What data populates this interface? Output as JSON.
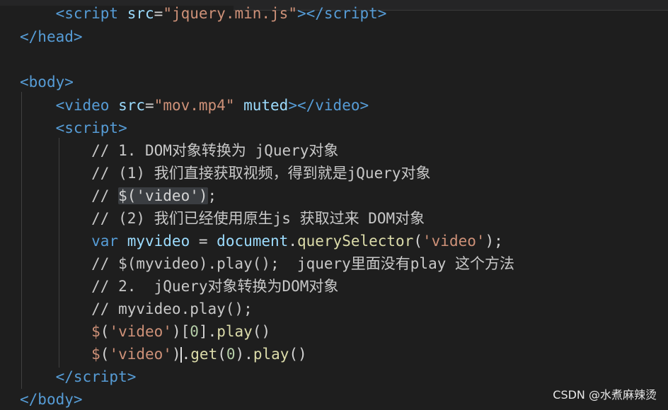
{
  "editor": {
    "lines": [
      {
        "parts": [
          [
            "tag",
            "    <"
          ],
          [
            "tag",
            "script"
          ],
          [
            "attr",
            " src"
          ],
          [
            "plain",
            "="
          ],
          [
            "str",
            "\"jquery.min.js\""
          ],
          [
            "tag",
            "></"
          ],
          [
            "tag",
            "script"
          ],
          [
            "tag",
            ">"
          ]
        ]
      },
      {
        "parts": [
          [
            "tag",
            "</"
          ],
          [
            "tag",
            "head"
          ],
          [
            "tag",
            ">"
          ]
        ]
      },
      {
        "parts": []
      },
      {
        "parts": [
          [
            "tag",
            "<"
          ],
          [
            "tag",
            "body"
          ],
          [
            "tag",
            ">"
          ]
        ]
      },
      {
        "parts": [
          [
            "tag",
            "    <"
          ],
          [
            "tag",
            "video"
          ],
          [
            "attr",
            " src"
          ],
          [
            "plain",
            "="
          ],
          [
            "str",
            "\"mov.mp4\""
          ],
          [
            "attr",
            " muted"
          ],
          [
            "tag",
            "></"
          ],
          [
            "tag",
            "video"
          ],
          [
            "tag",
            ">"
          ]
        ]
      },
      {
        "parts": [
          [
            "tag",
            "    <"
          ],
          [
            "tag",
            "script"
          ],
          [
            "tag",
            ">"
          ]
        ]
      },
      {
        "parts": [
          [
            "cmt",
            "        // 1. DOM对象转换为 jQuery对象"
          ]
        ]
      },
      {
        "parts": [
          [
            "cmt",
            "        // (1) 我们直接获取视频，得到就是jQuery对象"
          ]
        ]
      },
      {
        "parts": [
          [
            "cmt",
            "        // "
          ],
          [
            "hl",
            "$('video')"
          ],
          [
            "cmt",
            ";"
          ]
        ]
      },
      {
        "parts": [
          [
            "cmt",
            "        // (2) 我们已经使用原生js 获取过来 DOM对象"
          ]
        ]
      },
      {
        "parts": [
          [
            "kw",
            "        var"
          ],
          [
            "var",
            " myvideo"
          ],
          [
            "plain",
            " = "
          ],
          [
            "var",
            "document"
          ],
          [
            "plain",
            "."
          ],
          [
            "fn",
            "querySelector"
          ],
          [
            "plain",
            "("
          ],
          [
            "str",
            "'video'"
          ],
          [
            "plain",
            ");"
          ]
        ]
      },
      {
        "parts": [
          [
            "cmt",
            "        // $(myvideo).play();  jquery里面没有play 这个方法"
          ]
        ]
      },
      {
        "parts": [
          [
            "cmt",
            "        // 2.  jQuery对象转换为DOM对象"
          ]
        ]
      },
      {
        "parts": [
          [
            "cmt",
            "        // myvideo.play();"
          ]
        ]
      },
      {
        "parts": [
          [
            "dollar",
            "        $"
          ],
          [
            "plain",
            "("
          ],
          [
            "str",
            "'video'"
          ],
          [
            "plain",
            ")"
          ],
          [
            "plain",
            "["
          ],
          [
            "num",
            "0"
          ],
          [
            "plain",
            "]"
          ],
          [
            "plain",
            "."
          ],
          [
            "fn",
            "play"
          ],
          [
            "plain",
            "()"
          ]
        ]
      },
      {
        "parts": [
          [
            "dollar",
            "        $"
          ],
          [
            "plain",
            "("
          ],
          [
            "str",
            "'video'"
          ],
          [
            "plain",
            ")"
          ],
          [
            "cursor",
            ""
          ],
          [
            "plain",
            "."
          ],
          [
            "fn",
            "get"
          ],
          [
            "plain",
            "("
          ],
          [
            "num",
            "0"
          ],
          [
            "plain",
            ")."
          ],
          [
            "fn",
            "play"
          ],
          [
            "plain",
            "()"
          ]
        ]
      },
      {
        "parts": [
          [
            "tag",
            "    </"
          ],
          [
            "tag",
            "script"
          ],
          [
            "tag",
            ">"
          ]
        ]
      },
      {
        "parts": [
          [
            "tag",
            "</"
          ],
          [
            "tag",
            "body"
          ],
          [
            "tag",
            ">"
          ]
        ]
      }
    ]
  },
  "watermark": "CSDN @水煮麻辣烫"
}
